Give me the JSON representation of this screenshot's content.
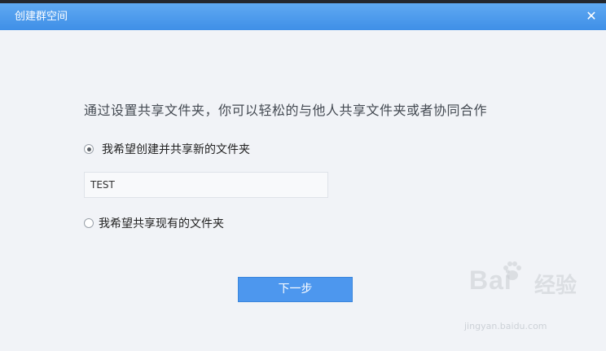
{
  "window": {
    "title": "创建群空间",
    "close_glyph": "✕"
  },
  "content": {
    "intro": "通过设置共享文件夹，你可以轻松的与他人共享文件夹或者协同合作",
    "option_create_label": "我希望创建并共享新的文件夹",
    "folder_name_value": "TEST",
    "option_existing_label": "我希望共享现有的文件夹",
    "next_button_label": "下一步"
  },
  "watermark": {
    "brand": "Bai",
    "brand_suffix": "经验",
    "url": "jingyan.baidu.com"
  },
  "colors": {
    "titlebar": "#4a9bef",
    "accent_button": "#4d97ee",
    "background": "#f1f3f7"
  }
}
